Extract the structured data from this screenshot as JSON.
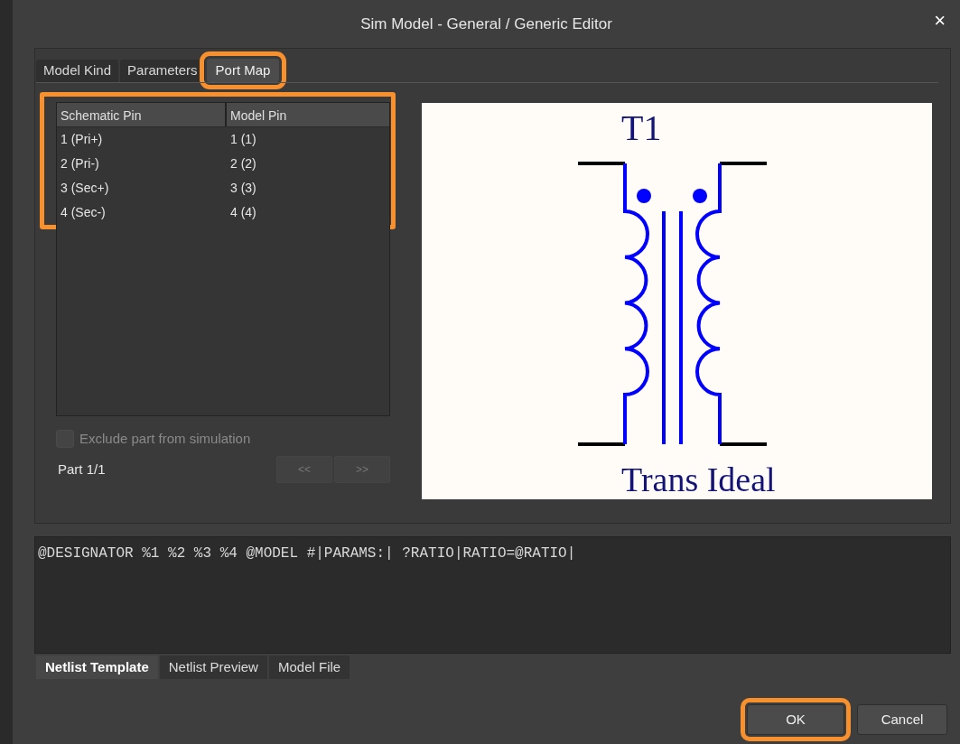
{
  "window": {
    "title": "Sim Model - General / Generic Editor",
    "close": "×"
  },
  "tabs": [
    {
      "label": "Model Kind",
      "selected": false,
      "highlighted": false
    },
    {
      "label": "Parameters",
      "selected": false,
      "highlighted": false
    },
    {
      "label": "Port Map",
      "selected": true,
      "highlighted": true
    }
  ],
  "port_map": {
    "highlighted": true,
    "columns": [
      "Schematic Pin",
      "Model Pin"
    ],
    "rows": [
      [
        "1 (Pri+)",
        "1 (1)"
      ],
      [
        "2 (Pri-)",
        "2 (2)"
      ],
      [
        "3 (Sec+)",
        "3 (3)"
      ],
      [
        "4 (Sec-)",
        "4 (4)"
      ]
    ]
  },
  "exclude": {
    "label": "Exclude part from simulation",
    "checked": false,
    "disabled": true
  },
  "part": "Part 1/1",
  "nav_buttons": [
    {
      "label": "<<",
      "disabled": true
    },
    {
      "label": ">>",
      "disabled": true
    }
  ],
  "preview": {
    "designator": "T1",
    "name": "Trans Ideal"
  },
  "netlist_template": "@DESIGNATOR %1 %2 %3 %4 @MODEL #|PARAMS:| ?RATIO|RATIO=@RATIO|",
  "bottom_tabs": [
    {
      "label": "Netlist Template",
      "selected": true
    },
    {
      "label": "Netlist Preview",
      "selected": false
    },
    {
      "label": "Model File",
      "selected": false
    }
  ],
  "buttons": [
    {
      "label": "OK",
      "highlighted": true
    },
    {
      "label": "Cancel",
      "highlighted": false
    }
  ]
}
